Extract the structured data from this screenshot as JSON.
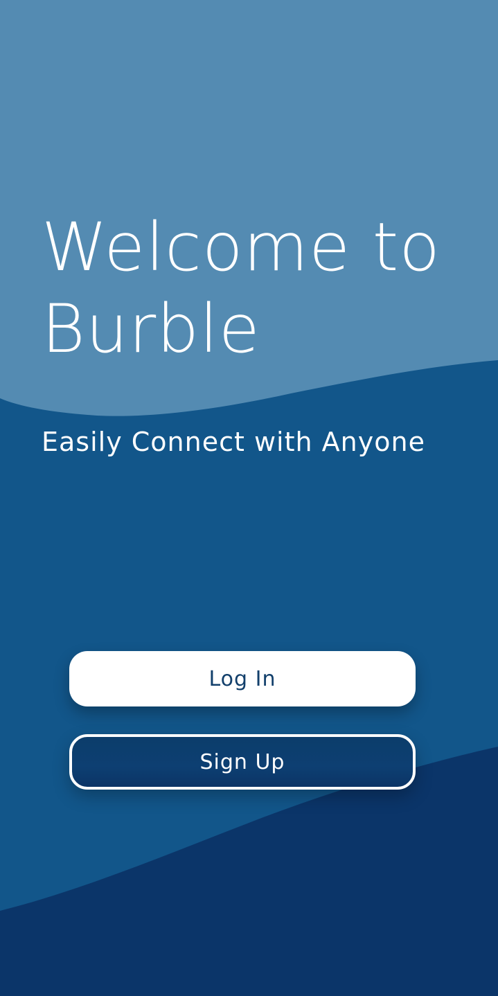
{
  "welcome": {
    "title_line1": "Welcome to",
    "title_line2": "Burble",
    "subtitle": "Easily Connect with Anyone"
  },
  "buttons": {
    "login_label": "Log In",
    "signup_label": "Sign Up"
  },
  "colors": {
    "top_wave": "#548bb2",
    "middle_wave": "#12568a",
    "bottom_wave": "#0b3569",
    "login_bg": "#ffffff",
    "login_text": "#123f6b",
    "signup_border": "#ffffff"
  }
}
